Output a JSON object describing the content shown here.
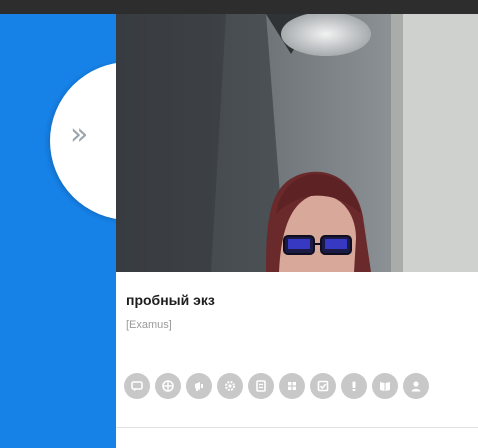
{
  "sidebar": {
    "expand_glyph": "»",
    "accent_color": "#1681e6"
  },
  "video": {
    "description_icon": "webcam-feed"
  },
  "exam": {
    "title": "пробный экз",
    "provider": "[Examus]"
  },
  "icons": [
    "chat-icon",
    "globe-icon",
    "megaphone-icon",
    "settings-icon",
    "document-icon",
    "grid-icon",
    "checklist-icon",
    "info-icon",
    "book-icon",
    "user-icon"
  ]
}
